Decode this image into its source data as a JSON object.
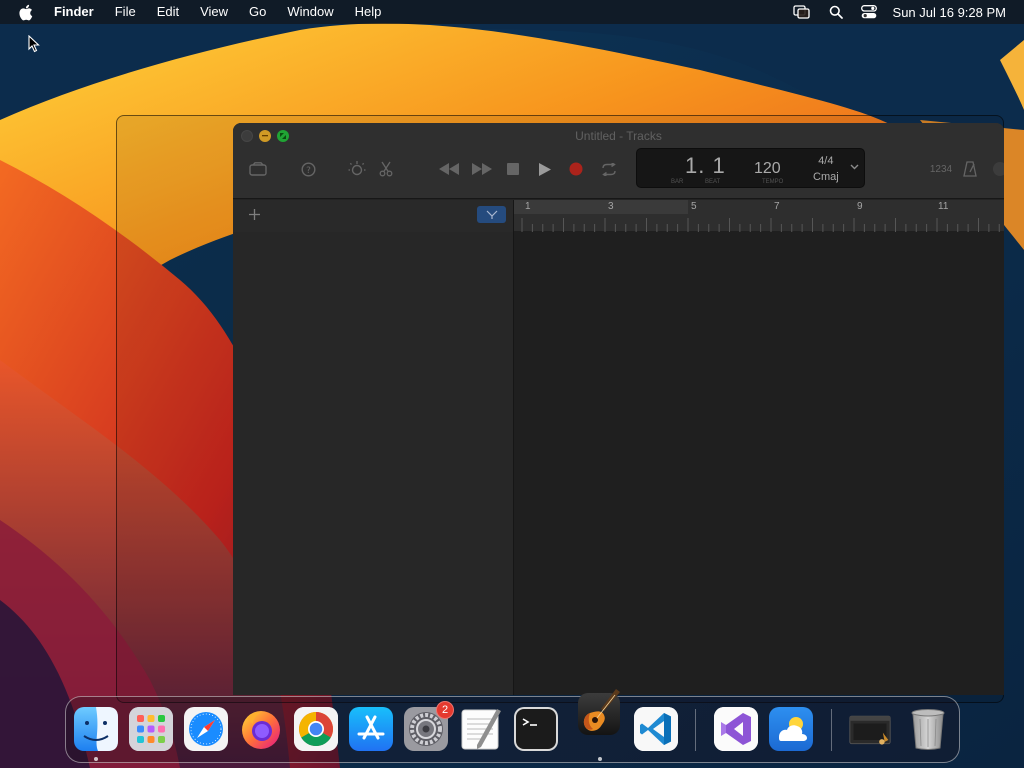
{
  "menubar": {
    "app_name": "Finder",
    "menus": [
      "File",
      "Edit",
      "View",
      "Go",
      "Window",
      "Help"
    ],
    "clock": "Sun Jul 16  9:28 PM"
  },
  "window": {
    "title": "Untitled - Tracks",
    "lcd": {
      "position": "1. 1",
      "bar_label": "BAR",
      "beat_label": "BEAT",
      "tempo": "120",
      "tempo_label": "TEMPO",
      "time_signature": "4/4",
      "key": "Cmaj"
    },
    "count_in": "1234",
    "ruler_numbers": [
      "1",
      "3",
      "5",
      "7",
      "9",
      "11"
    ]
  },
  "dock": {
    "items": [
      {
        "name": "Finder",
        "icon": "finder-icon",
        "running": true
      },
      {
        "name": "Launchpad",
        "icon": "launchpad-icon",
        "running": false
      },
      {
        "name": "Safari",
        "icon": "safari-icon",
        "running": false
      },
      {
        "name": "Firefox",
        "icon": "firefox-icon",
        "running": false
      },
      {
        "name": "Chrome",
        "icon": "chrome-icon",
        "running": false
      },
      {
        "name": "App Store",
        "icon": "app-store-icon",
        "running": false
      },
      {
        "name": "System Settings",
        "icon": "system-settings-icon",
        "running": false,
        "badge": "2"
      },
      {
        "name": "TextEdit",
        "icon": "textedit-icon",
        "running": false
      },
      {
        "name": "Terminal",
        "icon": "terminal-icon",
        "running": false
      },
      {
        "name": "GarageBand",
        "icon": "garageband-icon",
        "running": true
      },
      {
        "name": "Visual Studio Code",
        "icon": "vscode-icon",
        "running": false
      },
      {
        "name": "Visual Studio",
        "icon": "visual-studio-icon",
        "running": false
      },
      {
        "name": "Weather",
        "icon": "weather-icon",
        "running": false
      },
      {
        "name": "Downloads",
        "icon": "downloads-stack-icon",
        "running": false
      },
      {
        "name": "Trash",
        "icon": "trash-icon",
        "running": false
      }
    ]
  },
  "colors": {
    "wallpaper_orange": "#f7a21b",
    "wallpaper_red": "#e0431c",
    "wallpaper_navy": "#0b2a48",
    "record_red": "#d12b22",
    "badge_red": "#e5392f"
  }
}
